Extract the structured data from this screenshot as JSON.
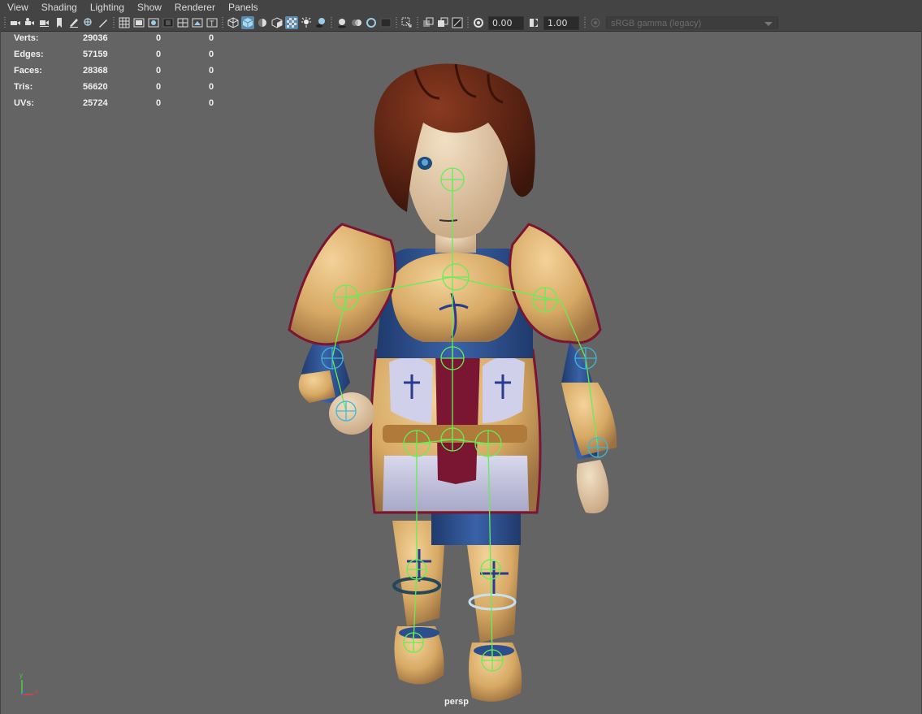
{
  "menu": [
    "View",
    "Shading",
    "Lighting",
    "Show",
    "Renderer",
    "Panels"
  ],
  "toolbar": {
    "exposure_value": "0.00",
    "gamma_value": "1.00",
    "color_space": "sRGB gamma (legacy)",
    "icons": [
      "camera-select-icon",
      "camera-attributes-icon",
      "bookmark-icon",
      "image-plane-icon",
      "grid-icon",
      "film-gate-icon",
      "resolution-gate-icon",
      "gate-mask-icon",
      "field-chart-icon",
      "safe-action-icon",
      "safe-title-icon",
      "wireframe-icon",
      "smooth-shade-icon",
      "default-material-icon",
      "shade-selected-icon",
      "textured-icon",
      "lights-icon",
      "shadows-icon",
      "screen-ambient-occlusion-icon",
      "motion-blur-icon",
      "multisample-aa-icon",
      "depth-of-field-icon",
      "isolate-select-icon",
      "xray-icon",
      "xray-joints-icon",
      "xray-components-icon",
      "exposure-icon",
      "gamma-icon",
      "color-management-icon"
    ]
  },
  "hud": {
    "rows": [
      {
        "label": "Verts:",
        "v1": "29036",
        "v2": "0",
        "v3": "0"
      },
      {
        "label": "Edges:",
        "v1": "57159",
        "v2": "0",
        "v3": "0"
      },
      {
        "label": "Faces:",
        "v1": "28368",
        "v2": "0",
        "v3": "0"
      },
      {
        "label": "Tris:",
        "v1": "56620",
        "v2": "0",
        "v3": "0"
      },
      {
        "label": "UVs:",
        "v1": "25724",
        "v2": "0",
        "v3": "0"
      }
    ]
  },
  "viewport": {
    "camera": "persp",
    "axis_y": "y",
    "axis_x": "x",
    "colors": {
      "background": "#646464",
      "skin": "#e2c7a4",
      "armor": "#d7a964",
      "hair": "#5b2314",
      "cloth_blue": "#2c4e8c",
      "crimson": "#7a1532",
      "joint": "#66ee55"
    }
  }
}
